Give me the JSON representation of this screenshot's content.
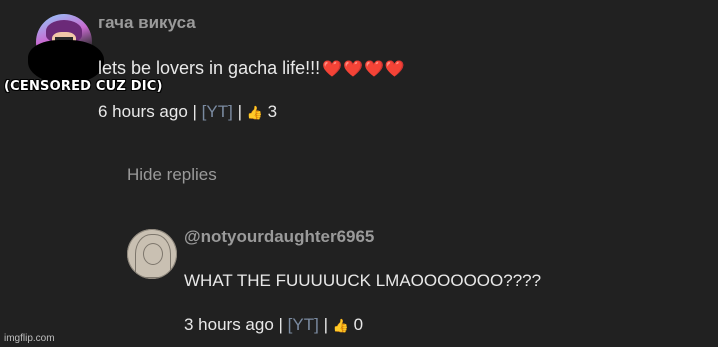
{
  "comment": {
    "author": "гача викуса",
    "text": "lets be lovers in gacha life!!!",
    "hearts": "❤️❤️❤️❤️",
    "time": "6 hours ago",
    "separator": " | ",
    "yt": "[YT]",
    "thumb_icon": "👍",
    "likes": "3"
  },
  "censor_note": "(CENSORED CUZ DIC)",
  "hide_replies": "Hide replies",
  "reply": {
    "author": "@notyourdaughter6965",
    "text": "WHAT THE FUUUUUCK LMAOOOOOOO????",
    "time": "3 hours ago",
    "separator": " | ",
    "yt": "[YT]",
    "thumb_icon": "👍",
    "likes": "0"
  },
  "watermark": "imgflip.com",
  "colors": {
    "background": "#212121",
    "muted": "#9a9a9a",
    "text": "#e8e8e8",
    "heart": "#e0242c",
    "link": "#7a8aa0"
  }
}
